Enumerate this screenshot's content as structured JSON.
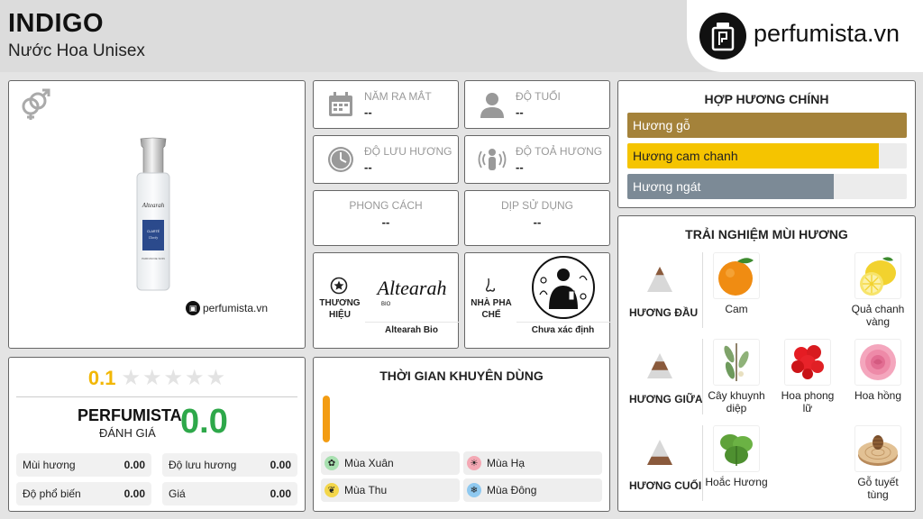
{
  "product": {
    "title": "INDIGO",
    "subtitle": "Nước Hoa Unisex",
    "watermark": "perfumista.vn",
    "bottle_brand": "Altearah",
    "bottle_label": "CLARTÉ",
    "bottle_sublabel": "Clarity",
    "bottle_footer": "PARFUM DE SOIN"
  },
  "brand_site": "perfumista.vn",
  "rating": {
    "value": "0.1",
    "stars_filled": 0,
    "stars_total": 5,
    "perfumista_label": "PERFUMISTA",
    "perfumista_sub": "ĐÁNH GIÁ",
    "perfumista_score": "0.0",
    "metrics": [
      {
        "label": "Mùi hương",
        "value": "0.00"
      },
      {
        "label": "Độ lưu hương",
        "value": "0.00"
      },
      {
        "label": "Độ phổ biến",
        "value": "0.00"
      },
      {
        "label": "Giá",
        "value": "0.00"
      }
    ]
  },
  "info": {
    "launch_year": {
      "label": "NĂM RA MẮT",
      "value": "--"
    },
    "age": {
      "label": "ĐỘ TUỔI",
      "value": "--"
    },
    "longevity": {
      "label": "ĐỘ LƯU HƯƠNG",
      "value": "--"
    },
    "sillage": {
      "label": "ĐỘ TOẢ HƯƠNG",
      "value": "--"
    },
    "style": {
      "label": "PHONG CÁCH",
      "value": "--"
    },
    "occasion": {
      "label": "DỊP SỬ DỤNG",
      "value": "--"
    }
  },
  "brand": {
    "label": "THƯƠNG HIỆU",
    "name": "Altearah Bio",
    "logo_text": "Altearah",
    "logo_sub": "BIO"
  },
  "perfumer": {
    "label": "NHÀ PHA CHẾ",
    "name": "Chưa xác định"
  },
  "recommended_time": {
    "title": "THỜI GIAN KHUYÊN DÙNG",
    "level": 1.0,
    "seasons": [
      {
        "label": "Mùa Xuân",
        "color": "#a8e0b0"
      },
      {
        "label": "Mùa Hạ",
        "color": "#f4a8b4"
      },
      {
        "label": "Mùa Thu",
        "color": "#f3d64a"
      },
      {
        "label": "Mùa Đông",
        "color": "#8fc9f0"
      }
    ]
  },
  "accords": {
    "title": "HỢP HƯƠNG CHÍNH",
    "items": [
      {
        "label": "Hương gỗ",
        "color": "#a4823a",
        "level": 1.0
      },
      {
        "label": "Hương cam chanh",
        "color": "#f5c400",
        "level": 0.9
      },
      {
        "label": "Hương ngát",
        "color": "#7c8a96",
        "level": 0.74
      }
    ]
  },
  "experience": {
    "title": "TRẢI NGHIỆM MÙI HƯƠNG",
    "tiers": [
      {
        "label": "HƯƠNG ĐẦU",
        "notes": [
          "Cam",
          "Quả chanh vàng"
        ]
      },
      {
        "label": "HƯƠNG GIỮA",
        "notes": [
          "Cây khuynh diệp",
          "Hoa phong lữ",
          "Hoa hồng"
        ]
      },
      {
        "label": "HƯƠNG CUỐI",
        "notes": [
          "Hoắc Hương",
          "Gỗ tuyết tùng"
        ]
      }
    ]
  }
}
